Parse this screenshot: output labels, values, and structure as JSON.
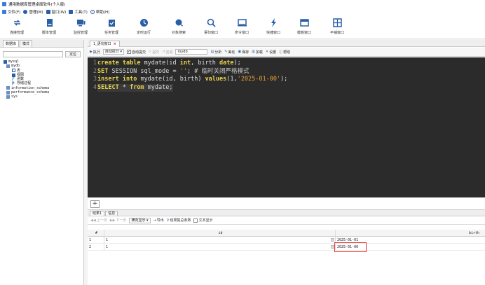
{
  "window": {
    "title": "通用数据库管理桌面软件(个人版)"
  },
  "menu": [
    {
      "label": "文件(F)",
      "color": "#3a7fd5"
    },
    {
      "label": "管理(M)",
      "color": "#2a5fa8"
    },
    {
      "label": "窗口(W)",
      "color": "#2a5fa8"
    },
    {
      "label": "工具(T)",
      "color": "#2a5fa8"
    },
    {
      "label": "帮助(H)",
      "color": "#2a5fa8"
    }
  ],
  "toolbar": [
    {
      "label": "连接管理",
      "icon": "sync-icon"
    },
    {
      "label": "脚本管理",
      "icon": "script-icon"
    },
    {
      "label": "监控管理",
      "icon": "monitor-icon"
    },
    {
      "label": "任务管理",
      "icon": "calendar-icon"
    },
    {
      "label": "定时运行",
      "icon": "clock-icon"
    },
    {
      "label": "对象搜索",
      "icon": "object-search-icon"
    },
    {
      "label": "语句窗口",
      "icon": "search-icon"
    },
    {
      "label": "命令窗口",
      "icon": "terminal-icon"
    },
    {
      "label": "快捷窗口",
      "icon": "lightning-icon"
    },
    {
      "label": "模板窗口",
      "icon": "template-icon"
    },
    {
      "label": "平铺窗口",
      "icon": "tile-icon"
    }
  ],
  "left_panel": {
    "tabs": [
      "数据库",
      "模式"
    ],
    "go_label": "定位",
    "tree": [
      {
        "label": "mysql",
        "level": 0
      },
      {
        "label": "mydb",
        "level": 1
      },
      {
        "label": "表",
        "level": 2
      },
      {
        "label": "视图",
        "level": 2
      },
      {
        "label": "函数",
        "level": 2
      },
      {
        "label": "存储过程",
        "level": 2
      },
      {
        "label": "information_schema",
        "level": 1
      },
      {
        "label": "performance_schema",
        "level": 1
      },
      {
        "label": "sys",
        "level": 1
      }
    ]
  },
  "query_tab": {
    "label": "1_语句窗口"
  },
  "editor_toolbar": {
    "execute": "执行",
    "exec_mode": "自动拆分",
    "autocommit": "自动提交",
    "commit": "提交",
    "rollback": "回滚",
    "database": "mydb",
    "analyze": "分析",
    "beautify": "美化",
    "save": "保存",
    "load": "加载",
    "settings": "设置",
    "help": "帮助"
  },
  "editor": {
    "line_numbers": [
      "1",
      "2",
      "3",
      "4"
    ]
  },
  "results": {
    "tabs": [
      "结果1",
      "信息"
    ],
    "toolbar": {
      "prev": "上一页",
      "next": "下一页",
      "display_mode": "横向显示",
      "export": "导出",
      "search": "结果集总条数",
      "text_display": "文本显示"
    },
    "columns": [
      "#",
      "id",
      "birth"
    ],
    "rows": [
      [
        "1",
        "1",
        "2025-01-01"
      ],
      [
        "2",
        "1",
        "2025-01-00"
      ]
    ]
  }
}
